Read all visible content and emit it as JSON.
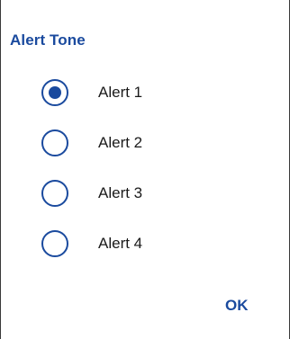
{
  "dialog": {
    "title": "Alert Tone",
    "options": [
      {
        "label": "Alert 1",
        "selected": true
      },
      {
        "label": "Alert 2",
        "selected": false
      },
      {
        "label": "Alert 3",
        "selected": false
      },
      {
        "label": "Alert 4",
        "selected": false
      }
    ],
    "ok_label": "OK"
  },
  "colors": {
    "accent": "#1a4a9e",
    "text": "#1a1a1a",
    "background": "#ffffff"
  }
}
